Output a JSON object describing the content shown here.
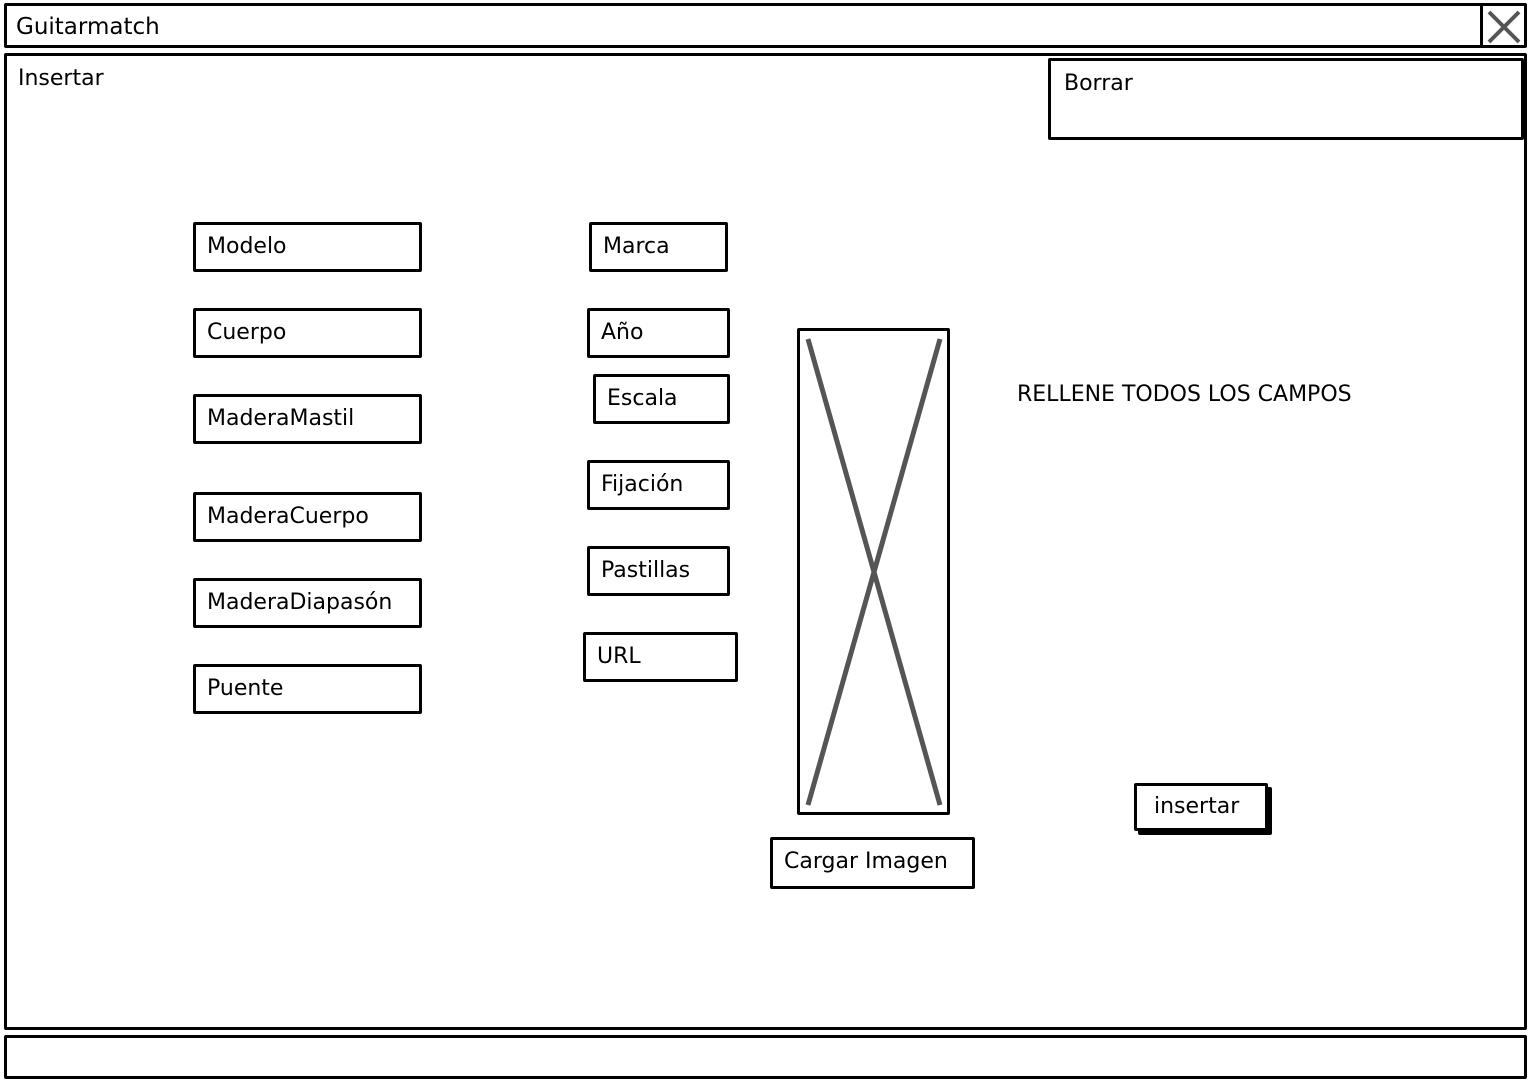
{
  "window": {
    "title": "Guitarmatch",
    "close_icon": "close-icon"
  },
  "tab": {
    "label": "Insertar"
  },
  "borrar": {
    "label": "Borrar"
  },
  "fields_left": [
    {
      "label": "Modelo"
    },
    {
      "label": "Cuerpo"
    },
    {
      "label": "MaderaMastil"
    },
    {
      "label": "MaderaCuerpo"
    },
    {
      "label": "MaderaDiapasón"
    },
    {
      "label": "Puente"
    }
  ],
  "fields_right": [
    {
      "label": "Marca"
    },
    {
      "label": "Año"
    },
    {
      "label": "Escala"
    },
    {
      "label": "Fijación"
    },
    {
      "label": "Pastillas"
    },
    {
      "label": "URL"
    }
  ],
  "image": {
    "icon": "image-placeholder-icon",
    "load_button_label": "Cargar Imagen"
  },
  "notice": "RELLENE TODOS LOS CAMPOS",
  "submit": {
    "label": "insertar"
  },
  "status_bar": {
    "text": ""
  }
}
